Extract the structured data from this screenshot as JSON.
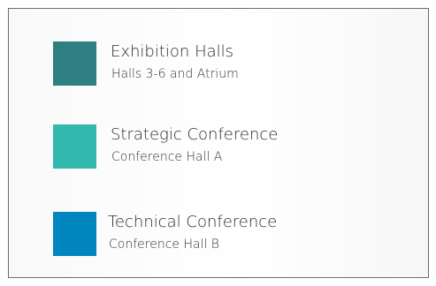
{
  "legend": {
    "items": [
      {
        "title": "Exhibition Halls",
        "subtitle": "Halls 3-6 and Atrium",
        "color": "#2d7f81"
      },
      {
        "title": "Strategic Conference",
        "subtitle": "Conference Hall A",
        "color": "#33b8ad"
      },
      {
        "title": "Technical Conference",
        "subtitle": "Conference Hall B",
        "color": "#0286bf"
      }
    ]
  }
}
